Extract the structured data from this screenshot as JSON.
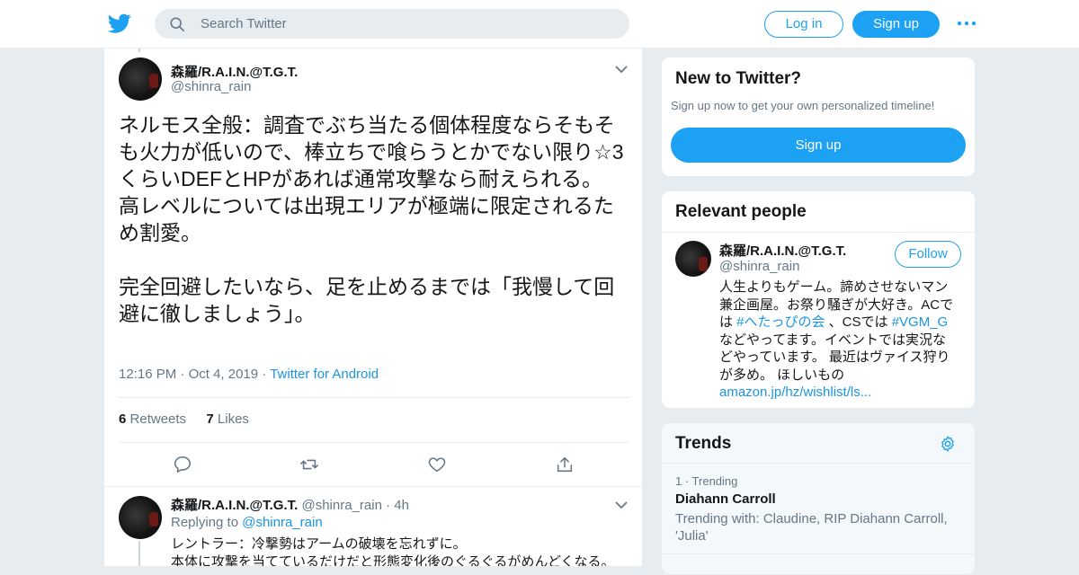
{
  "topbar": {
    "search_placeholder": "Search Twitter",
    "login_label": "Log in",
    "signup_label": "Sign up"
  },
  "tweet": {
    "author_name": "森羅/R.A.I.N.@T.G.T.",
    "author_handle": "@shinra_rain",
    "text": "ネルモス全般：調査でぶち当たる個体程度ならそもそも火力が低いので、棒立ちで喰らうとかでない限り☆3くらいDEFとHPがあれば通常攻撃なら耐えられる。\n高レベルについては出現エリアが極端に限定されるため割愛。\n\n完全回避したいなら、足を止めるまでは「我慢して回避に徹しましょう」。",
    "time": "12:16 PM",
    "date": "Oct 4, 2019",
    "source": "Twitter for Android",
    "retweets_count": "6",
    "retweets_label": "Retweets",
    "likes_count": "7",
    "likes_label": "Likes"
  },
  "reply": {
    "author_name": "森羅/R.A.I.N.@T.G.T.",
    "author_handle": "@shinra_rain",
    "age": "4h",
    "replying_label": "Replying to",
    "replying_handle": "@shinra_rain",
    "text_line1": "レントラー：冷撃勢はアームの破壊を忘れずに。",
    "text_line2": "本体に攻撃を当てているだけだと形態変化後のぐるぐるがめんどくなる。"
  },
  "sidebar": {
    "new_to_twitter": {
      "title": "New to Twitter?",
      "subtitle": "Sign up now to get your own personalized timeline!",
      "signup_label": "Sign up"
    },
    "relevant_people": {
      "title": "Relevant people",
      "name": "森羅/R.A.I.N.@T.G.T.",
      "handle": "@shinra_rain",
      "follow_label": "Follow",
      "bio_1": "人生よりもゲーム。諦めさせないマン兼企画屋。お祭り騒ぎが大好き。ACでは ",
      "bio_tag1": "#へたっぴの会",
      "bio_2": " 、CSでは ",
      "bio_tag2": "#VGM_G",
      "bio_3": " などやってます。イベントでは実況などやっています。 最近はヴァイス狩りが多め。 ほしいもの ",
      "bio_link": "amazon.jp/hz/wishlist/ls..."
    },
    "trends": {
      "title": "Trends",
      "item_rank": "1 · Trending",
      "item_name": "Diahann Carroll",
      "item_with": "Trending with: Claudine, RIP Diahann Carroll, 'Julia'"
    }
  },
  "colors": {
    "brand": "#1da1f2",
    "link": "#1b95e0",
    "muted": "#657786"
  }
}
